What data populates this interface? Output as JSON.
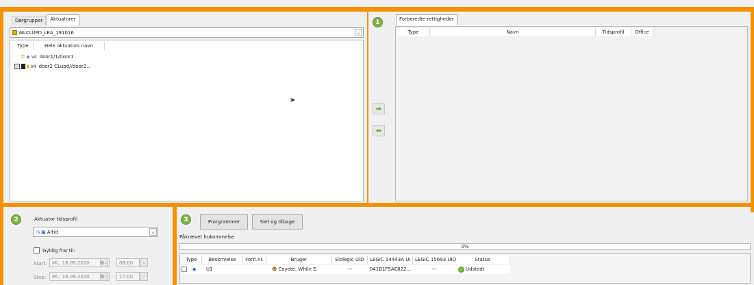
{
  "left_panel": {
    "tabs": [
      "Dørgrupper",
      "Aktuatorer"
    ],
    "active_tab": "Aktuatorer",
    "dropdown_value": "WLCLUPD_LEA_191016",
    "columns": [
      "Type",
      "Hele aktuators navn"
    ],
    "rows": [
      {
        "ver": "V4",
        "name": "door1/1/door1"
      },
      {
        "ver": "V4",
        "name": "door2  CLupd//door2..."
      }
    ]
  },
  "right_panel": {
    "badge": "1",
    "tabs": [
      "Forberedte rettigheder"
    ],
    "columns": [
      "Type",
      "Navn",
      "Tidsprofil",
      "Office"
    ]
  },
  "bottom_left": {
    "badge": "2",
    "profile_label": "Aktuator tidsprofil",
    "profile_value": "Altid",
    "valid_label": "Gyldig fra/ til:",
    "start_label": "Start:",
    "start_date": "Mi., 16.09.2020",
    "start_time": "08:00",
    "stop_label": "Stop:",
    "stop_date": "Mi., 16.09.2020",
    "stop_time": "17:00"
  },
  "bottom_right": {
    "badge": "3",
    "program_button": "Prorgrammer",
    "delete_button": "Slet og tilbage",
    "memory_label": "Påkrævet hukommelse",
    "progress": "0%",
    "columns": [
      "Type",
      "Beskrivelse",
      "Fortl.nr.",
      "Bruger",
      "Elolegic UID",
      "LEGIC 14443A UI",
      "LEGIC 15693 UID",
      "Status"
    ],
    "rows": [
      {
        "description": "U1",
        "serial": "",
        "user": "Coyote, While E.",
        "elolegic": "---",
        "legic14443": "041B1F5AE822...",
        "legic15693": "---",
        "status": "Udstedt"
      }
    ]
  },
  "colors": {
    "accent": "#f39200",
    "badge": "#7cb342",
    "arrow": "#6aab2e"
  }
}
